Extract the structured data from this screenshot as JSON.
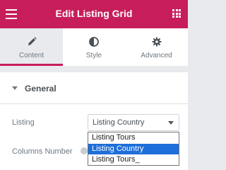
{
  "header": {
    "title": "Edit Listing Grid"
  },
  "tabs": [
    {
      "label": "Content",
      "icon": "pencil-icon"
    },
    {
      "label": "Style",
      "icon": "half-circle-icon"
    },
    {
      "label": "Advanced",
      "icon": "gear-icon"
    }
  ],
  "section": {
    "title": "General"
  },
  "fields": {
    "listing_label": "Listing",
    "columns_label": "Columns Number"
  },
  "listing_select": {
    "value": "Listing Country",
    "options": [
      "Listing Tours",
      "Listing Country",
      "Listing Tours_"
    ]
  },
  "colors": {
    "accent": "#c71e5b",
    "selected_option": "#1e6fd9"
  }
}
